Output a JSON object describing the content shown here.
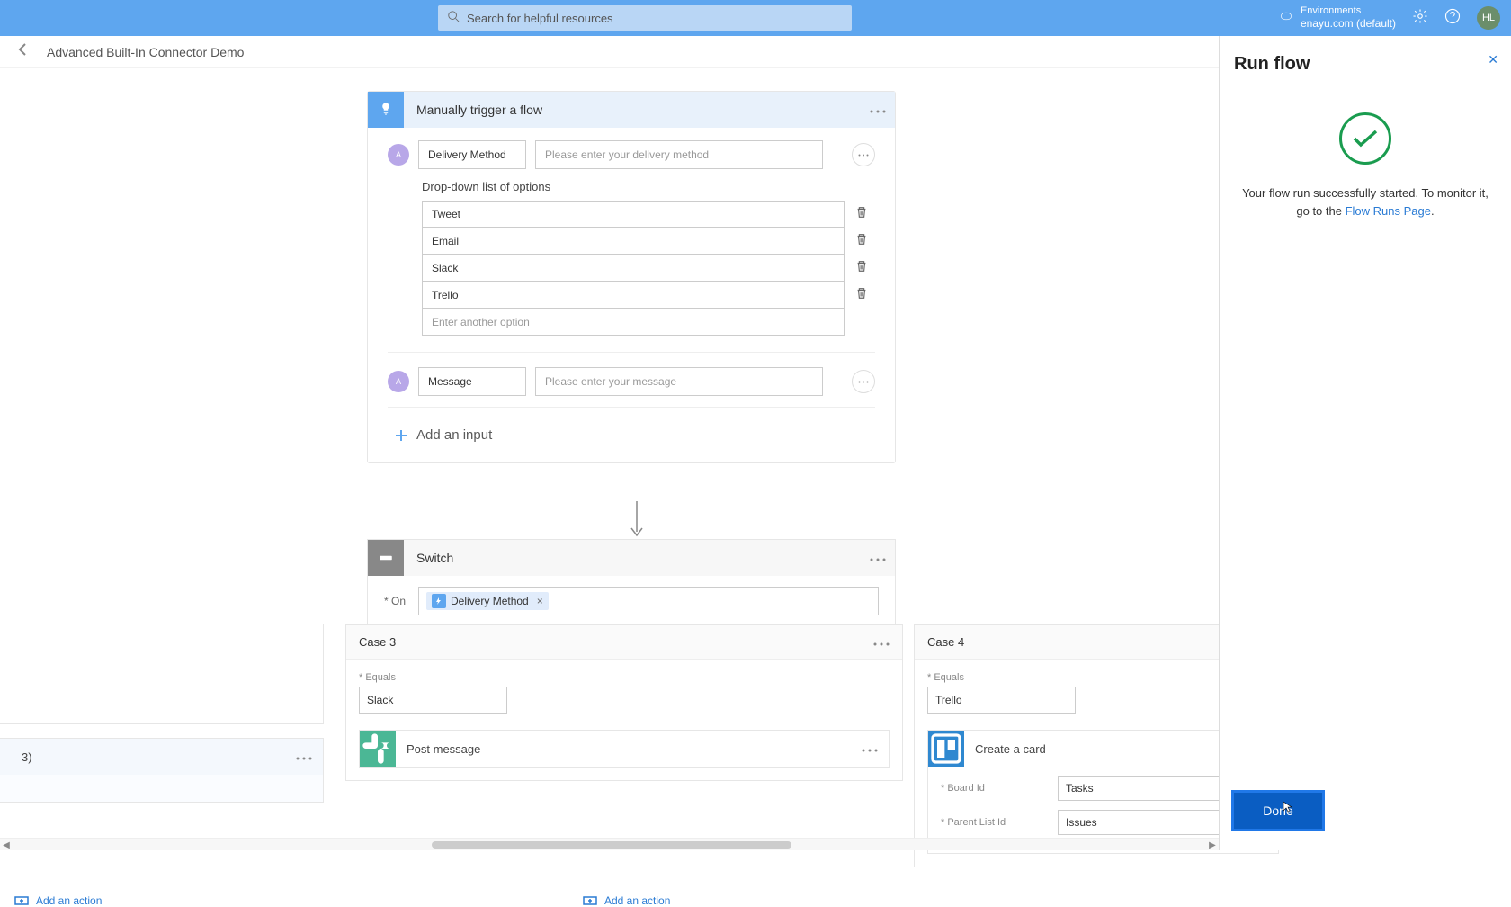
{
  "header": {
    "search_placeholder": "Search for helpful resources",
    "env_label": "Environments",
    "env_name": "enayu.com (default)",
    "avatar": "HL"
  },
  "crumb": {
    "title": "Advanced Built-In Connector Demo"
  },
  "trigger": {
    "title": "Manually trigger a flow",
    "param1_name": "Delivery Method",
    "param1_placeholder": "Please enter your delivery method",
    "dropdown_label": "Drop-down list of options",
    "options": [
      "Tweet",
      "Email",
      "Slack",
      "Trello"
    ],
    "add_option_placeholder": "Enter another option",
    "param2_name": "Message",
    "param2_placeholder": "Please enter your message",
    "add_input": "Add an input"
  },
  "switch": {
    "title": "Switch",
    "on_label": "* On",
    "token": "Delivery Method"
  },
  "cases": {
    "c2_partial": "3)",
    "c3_title": "Case 3",
    "c3_equals_label": "* Equals",
    "c3_equals_value": "Slack",
    "c3_action": "Post message",
    "c4_title": "Case 4",
    "c4_equals_label": "* Equals",
    "c4_equals_value": "Trello",
    "c4_action": "Create a card",
    "c4_board_label": "* Board Id",
    "c4_board_value": "Tasks",
    "c4_list_label": "* Parent List Id",
    "c4_list_value": "Issues",
    "add_action": "Add an action"
  },
  "panel": {
    "title": "Run flow",
    "msg_prefix": "Your flow run successfully started. To monitor it, go to the ",
    "msg_link": "Flow Runs Page",
    "done": "Done"
  }
}
